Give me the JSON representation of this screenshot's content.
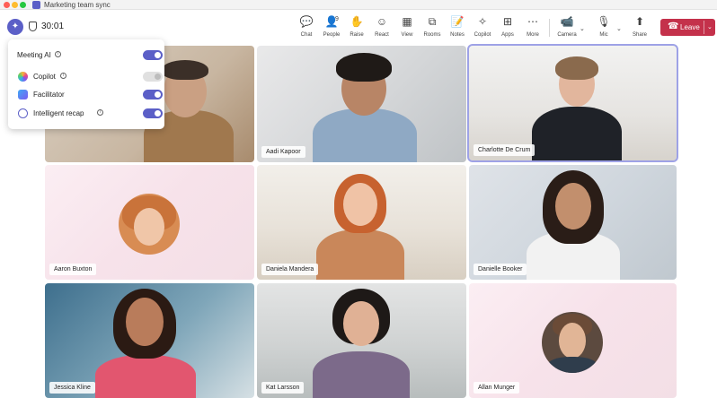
{
  "window": {
    "title": "Marketing team sync"
  },
  "meeting": {
    "timer": "30:01"
  },
  "toolbar": {
    "chat": {
      "label": "Chat",
      "icon": "chat-icon"
    },
    "people": {
      "label": "People",
      "count": "9",
      "icon": "people-icon"
    },
    "raise": {
      "label": "Raise",
      "icon": "hand-icon"
    },
    "react": {
      "label": "React",
      "icon": "smile-icon"
    },
    "view": {
      "label": "View",
      "icon": "grid-icon"
    },
    "rooms": {
      "label": "Rooms",
      "icon": "rooms-icon"
    },
    "notes": {
      "label": "Notes",
      "icon": "notes-icon"
    },
    "copilot": {
      "label": "Copilot",
      "icon": "copilot-icon"
    },
    "apps": {
      "label": "Apps",
      "icon": "plus-icon"
    },
    "more": {
      "label": "More",
      "icon": "ellipsis-icon"
    },
    "camera": {
      "label": "Camera",
      "icon": "camera-icon"
    },
    "mic": {
      "label": "Mic",
      "icon": "mic-icon"
    },
    "share": {
      "label": "Share",
      "icon": "share-icon"
    },
    "leave": {
      "label": "Leave",
      "color": "#c4314b"
    }
  },
  "ai_panel": {
    "title": "Meeting AI",
    "items": [
      {
        "label": "Copilot",
        "on": false
      },
      {
        "label": "Facilitator",
        "on": true
      },
      {
        "label": "Intelligent recap",
        "on": true
      }
    ],
    "title_toggle_on": true,
    "accent": "#5b5fc7"
  },
  "participants": [
    {
      "name": ""
    },
    {
      "name": "Aadi Kapoor"
    },
    {
      "name": "Charlotte De Crum",
      "active": true
    },
    {
      "name": "Aaron Buxton",
      "avatar": true
    },
    {
      "name": "Daniela Mandera"
    },
    {
      "name": "Danielle Booker"
    },
    {
      "name": "Jessica Kline"
    },
    {
      "name": "Kat Larsson"
    },
    {
      "name": "Allan Munger",
      "avatar": true
    }
  ]
}
